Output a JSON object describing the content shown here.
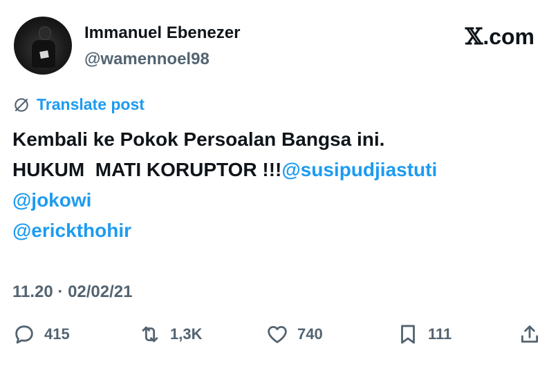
{
  "author": {
    "name": "Immanuel Ebenezer",
    "handle": "@wamennoel98"
  },
  "brand": {
    "x_glyph": "𝕏",
    "suffix": ".com"
  },
  "translate": {
    "label": "Translate post",
    "icon": "globe-slash-icon"
  },
  "post": {
    "line1": "Kembali ke Pokok Persoalan Bangsa ini.",
    "line2_text": "HUKUM  MATI KORUPTOR !!!",
    "line2_mention": "@susipudjiastuti",
    "mention2": "@jokowi",
    "mention3": "@erickthohir"
  },
  "meta": {
    "timestamp": "11.20 · 02/02/21"
  },
  "actions": {
    "reply": {
      "count": "415",
      "icon": "reply-icon"
    },
    "repost": {
      "count": "1,3K",
      "icon": "repost-icon"
    },
    "like": {
      "count": "740",
      "icon": "heart-icon"
    },
    "bookmark": {
      "count": "111",
      "icon": "bookmark-icon"
    },
    "share": {
      "icon": "share-icon"
    }
  },
  "colors": {
    "link": "#1d9bf0",
    "muted": "#536471",
    "text": "#0f1419"
  }
}
